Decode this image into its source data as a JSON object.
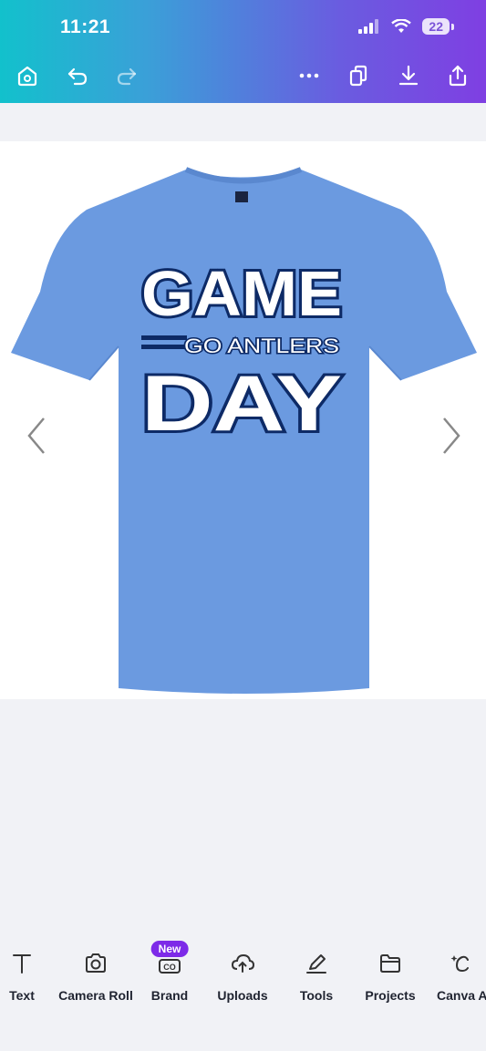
{
  "status_bar": {
    "time": "11:21",
    "battery": "22"
  },
  "toolbar": {
    "icons": [
      "home-icon",
      "undo-icon",
      "redo-icon",
      "more-icon",
      "copy-pages-icon",
      "download-icon",
      "share-icon"
    ]
  },
  "design": {
    "shirt_color": "#6b9ae0",
    "word_top": "GAME",
    "word_middle": "GO ANTLERS",
    "word_bottom": "DAY"
  },
  "bottom_tabs": [
    {
      "label": "Text",
      "icon": "text-icon"
    },
    {
      "label": "Camera Roll",
      "icon": "camera-icon"
    },
    {
      "label": "Brand",
      "icon": "brand-icon",
      "badge": "New"
    },
    {
      "label": "Uploads",
      "icon": "upload-cloud-icon"
    },
    {
      "label": "Tools",
      "icon": "pen-tool-icon"
    },
    {
      "label": "Projects",
      "icon": "folder-icon"
    },
    {
      "label": "Canva A",
      "icon": "canva-ai-icon"
    }
  ],
  "colors": {
    "accent": "#7d2ae8",
    "shirt": "#6b9ae0",
    "navy": "#0d2a66"
  }
}
